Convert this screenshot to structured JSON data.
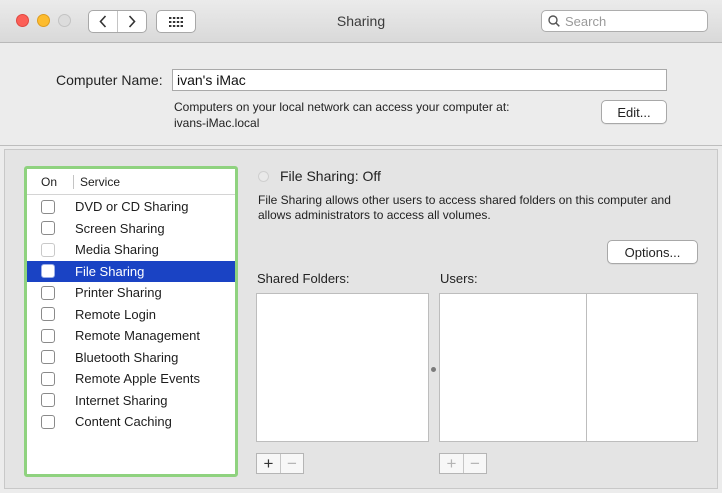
{
  "window": {
    "title": "Sharing",
    "search_placeholder": "Search"
  },
  "computer": {
    "label": "Computer Name:",
    "name": "ivan's iMac",
    "desc_line1": "Computers on your local network can access your computer at:",
    "desc_line2": "ivans-iMac.local",
    "edit_label": "Edit..."
  },
  "services": {
    "header_on": "On",
    "header_service": "Service",
    "items": [
      {
        "label": "DVD or CD Sharing",
        "checked": false
      },
      {
        "label": "Screen Sharing",
        "checked": false
      },
      {
        "label": "Media Sharing",
        "checked": false
      },
      {
        "label": "File Sharing",
        "checked": false,
        "selected": true
      },
      {
        "label": "Printer Sharing",
        "checked": false
      },
      {
        "label": "Remote Login",
        "checked": false
      },
      {
        "label": "Remote Management",
        "checked": false
      },
      {
        "label": "Bluetooth Sharing",
        "checked": false
      },
      {
        "label": "Remote Apple Events",
        "checked": false
      },
      {
        "label": "Internet Sharing",
        "checked": false
      },
      {
        "label": "Content Caching",
        "checked": false
      }
    ]
  },
  "detail": {
    "status": "File Sharing: Off",
    "description": "File Sharing allows other users to access shared folders on this computer and allows administrators to access all volumes.",
    "options_label": "Options...",
    "shared_folders_label": "Shared Folders:",
    "users_label": "Users:",
    "plus": "+",
    "minus": "−"
  },
  "colors": {
    "selection": "#1a43c4",
    "focus_ring": "#8fd27f",
    "close": "#fc5f57",
    "minimize": "#fdbc2e"
  }
}
